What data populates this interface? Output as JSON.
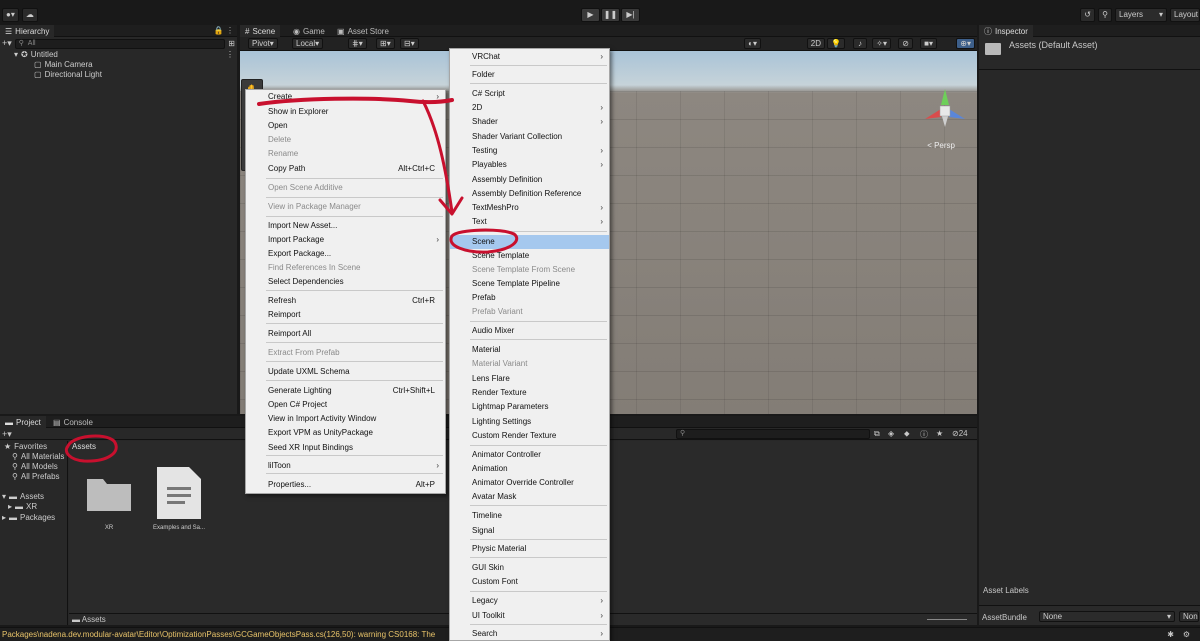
{
  "toolbar": {
    "play_label": "▶",
    "pause_label": "❚❚",
    "step_label": "▶|",
    "layers_label": "Layers",
    "layout_label": "Layout"
  },
  "hierarchy": {
    "tab_label": "Hierarchy",
    "search_placeholder": "All",
    "scene_name": "Untitled",
    "children": [
      "Main Camera",
      "Directional Light"
    ]
  },
  "scene": {
    "tabs": [
      "Scene",
      "Game",
      "Asset Store"
    ],
    "pivot_label": "Pivot",
    "local_label": "Local",
    "mode_2d_label": "2D",
    "persp_label": "Persp"
  },
  "inspector": {
    "tab_label": "Inspector",
    "title": "Assets (Default Asset)",
    "asset_labels": "Asset Labels",
    "asset_bundle_label": "AssetBundle",
    "asset_bundle_value": "None",
    "asset_variant_value": "None"
  },
  "project": {
    "tabs": [
      "Project",
      "Console"
    ],
    "favorites_label": "Favorites",
    "favorites": [
      "All Materials",
      "All Models",
      "All Prefabs"
    ],
    "assets_label": "Assets",
    "assets_children": [
      "XR"
    ],
    "packages_label": "Packages",
    "breadcrumb": "Assets",
    "items": [
      "XR",
      "Examples and Sa..."
    ],
    "hidden_count": "24",
    "footer_path": "Assets"
  },
  "status_message": "Packages\\nadena.dev.modular-avatar\\Editor\\OptimizationPasses\\GCGameObjectsPass.cs(126,50): warning CS0168: The",
  "context_menu": [
    {
      "label": "Create",
      "submenu": true
    },
    {
      "label": "Show in Explorer"
    },
    {
      "label": "Open"
    },
    {
      "label": "Delete",
      "disabled": true
    },
    {
      "label": "Rename",
      "disabled": true
    },
    {
      "label": "Copy Path",
      "shortcut": "Alt+Ctrl+C"
    },
    {
      "label": "Open Scene Additive",
      "disabled": true
    },
    {
      "label": "View in Package Manager",
      "disabled": true
    },
    {
      "label": "Import New Asset..."
    },
    {
      "label": "Import Package",
      "submenu": true
    },
    {
      "label": "Export Package..."
    },
    {
      "label": "Find References In Scene",
      "disabled": true
    },
    {
      "label": "Select Dependencies"
    },
    {
      "label": "Refresh",
      "shortcut": "Ctrl+R"
    },
    {
      "label": "Reimport"
    },
    {
      "label": "Reimport All"
    },
    {
      "label": "Extract From Prefab",
      "disabled": true
    },
    {
      "label": "Update UXML Schema"
    },
    {
      "label": "Generate Lighting",
      "shortcut": "Ctrl+Shift+L"
    },
    {
      "label": "Open C# Project"
    },
    {
      "label": "View in Import Activity Window"
    },
    {
      "label": "Export VPM as UnityPackage"
    },
    {
      "label": "Seed XR Input Bindings"
    },
    {
      "label": "lilToon",
      "submenu": true
    },
    {
      "label": "Properties...",
      "shortcut": "Alt+P"
    }
  ],
  "create_menu": [
    {
      "label": "VRChat",
      "submenu": true
    },
    {
      "label": "Folder"
    },
    {
      "label": "C# Script"
    },
    {
      "label": "2D",
      "submenu": true
    },
    {
      "label": "Shader",
      "submenu": true
    },
    {
      "label": "Shader Variant Collection"
    },
    {
      "label": "Testing",
      "submenu": true
    },
    {
      "label": "Playables",
      "submenu": true
    },
    {
      "label": "Assembly Definition"
    },
    {
      "label": "Assembly Definition Reference"
    },
    {
      "label": "TextMeshPro",
      "submenu": true
    },
    {
      "label": "Text",
      "submenu": true
    },
    {
      "label": "Scene",
      "highlighted": true
    },
    {
      "label": "Scene Template"
    },
    {
      "label": "Scene Template From Scene",
      "disabled": true
    },
    {
      "label": "Scene Template Pipeline"
    },
    {
      "label": "Prefab"
    },
    {
      "label": "Prefab Variant",
      "disabled": true
    },
    {
      "label": "Audio Mixer"
    },
    {
      "label": "Material"
    },
    {
      "label": "Material Variant",
      "disabled": true
    },
    {
      "label": "Lens Flare"
    },
    {
      "label": "Render Texture"
    },
    {
      "label": "Lightmap Parameters"
    },
    {
      "label": "Lighting Settings"
    },
    {
      "label": "Custom Render Texture"
    },
    {
      "label": "Animator Controller"
    },
    {
      "label": "Animation"
    },
    {
      "label": "Animator Override Controller"
    },
    {
      "label": "Avatar Mask"
    },
    {
      "label": "Timeline"
    },
    {
      "label": "Signal"
    },
    {
      "label": "Physic Material"
    },
    {
      "label": "GUI Skin"
    },
    {
      "label": "Custom Font"
    },
    {
      "label": "Legacy",
      "submenu": true
    },
    {
      "label": "UI Toolkit",
      "submenu": true
    },
    {
      "label": "Search",
      "submenu": true
    }
  ],
  "colors": {
    "panel_bg": "#282828",
    "menu_bg": "#f0f0f0",
    "menu_highlight": "#a5c8ee",
    "annotation_red": "#c8102e",
    "warning_text": "#e9c46a"
  }
}
